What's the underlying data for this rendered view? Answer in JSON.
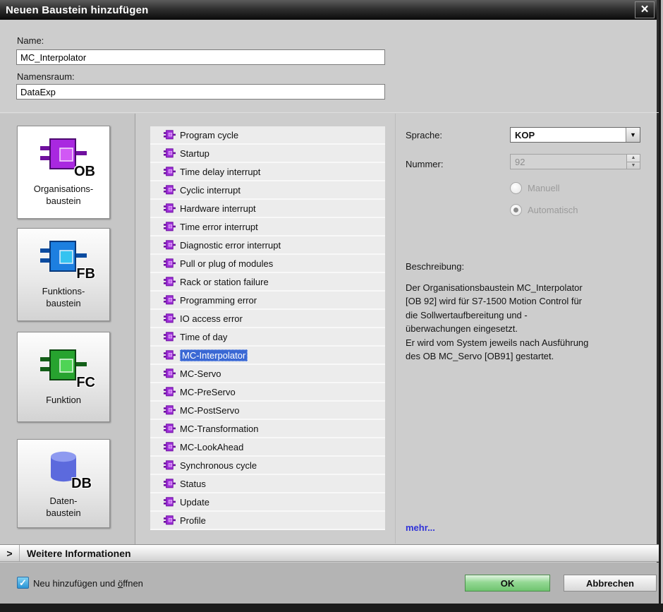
{
  "window": {
    "title": "Neuen Baustein hinzufügen",
    "close_icon": "×"
  },
  "form": {
    "name_label": "Name:",
    "name_value": "MC_Interpolator",
    "namespace_label": "Namensraum:",
    "namespace_value": "DataExp"
  },
  "block_types": [
    {
      "abbr": "OB",
      "label": "Organisations-\nbaustein",
      "selected": true,
      "color": "#a928e0",
      "color_dark": "#70109f",
      "color_inner": "#d158f5"
    },
    {
      "abbr": "FB",
      "label": "Funktions-\nbaustein",
      "selected": false,
      "color": "#1d7fe0",
      "color_dark": "#0b4ba0",
      "color_inner": "#35c3f0"
    },
    {
      "abbr": "FC",
      "label": "Funktion",
      "selected": false,
      "color": "#27a32f",
      "color_dark": "#135f18",
      "color_inner": "#4fd455"
    },
    {
      "abbr": "DB",
      "label": "Daten-\nbaustein",
      "selected": false,
      "color": "#5c6add",
      "color_dark": "#3b49b4",
      "color_inner": "#8e9af0"
    }
  ],
  "ob_list": {
    "selected_index": 12,
    "icon_colors": {
      "body": "#9e2fd8",
      "dark": "#6f0fa2",
      "inner": "#c55ef0",
      "inner_edge": "#ecccfa"
    },
    "items": [
      "Program cycle",
      "Startup",
      "Time delay interrupt",
      "Cyclic interrupt",
      "Hardware interrupt",
      "Time error interrupt",
      "Diagnostic error interrupt",
      "Pull or plug of modules",
      "Rack or station failure",
      "Programming error",
      "IO access error",
      "Time of day",
      "MC-Interpolator",
      "MC-Servo",
      "MC-PreServo",
      "MC-PostServo",
      "MC-Transformation",
      "MC-LookAhead",
      "Synchronous cycle",
      "Status",
      "Update",
      "Profile"
    ]
  },
  "properties": {
    "language_label": "Sprache:",
    "language_value": "KOP",
    "dropdown_icon": "▼",
    "number_label": "Nummer:",
    "number_value": "92",
    "spinner_up_icon": "▲",
    "spinner_down_icon": "▼",
    "manual_label": "Manuell",
    "automatic_label": "Automatisch",
    "selected_mode": "Automatisch",
    "description_label": "Beschreibung:",
    "description_text": "Der Organisationsbaustein MC_Interpolator\n[OB 92] wird für S7-1500 Motion Control für\ndie Sollwertaufbereitung und -\nüberwachungen eingesetzt.\nEr wird vom System jeweils nach Ausführung\ndes OB MC_Servo [OB91] gestartet.",
    "more_link": "mehr..."
  },
  "footer": {
    "expander_icon": ">",
    "more_info_label": "Weitere Informationen",
    "checkbox_checked": true,
    "check_icon": "✓",
    "checkbox_label_pre": "Neu hinzufügen und ",
    "checkbox_accel_char": "ö",
    "checkbox_label_post": "ffnen",
    "ok_label": "OK",
    "cancel_label": "Abbrechen"
  },
  "colors": {
    "selection_blue": "#3a68d4",
    "ok_green": "#79cc79",
    "link_blue": "#3032d8",
    "titlebar_dark": "#1c1c1c"
  }
}
